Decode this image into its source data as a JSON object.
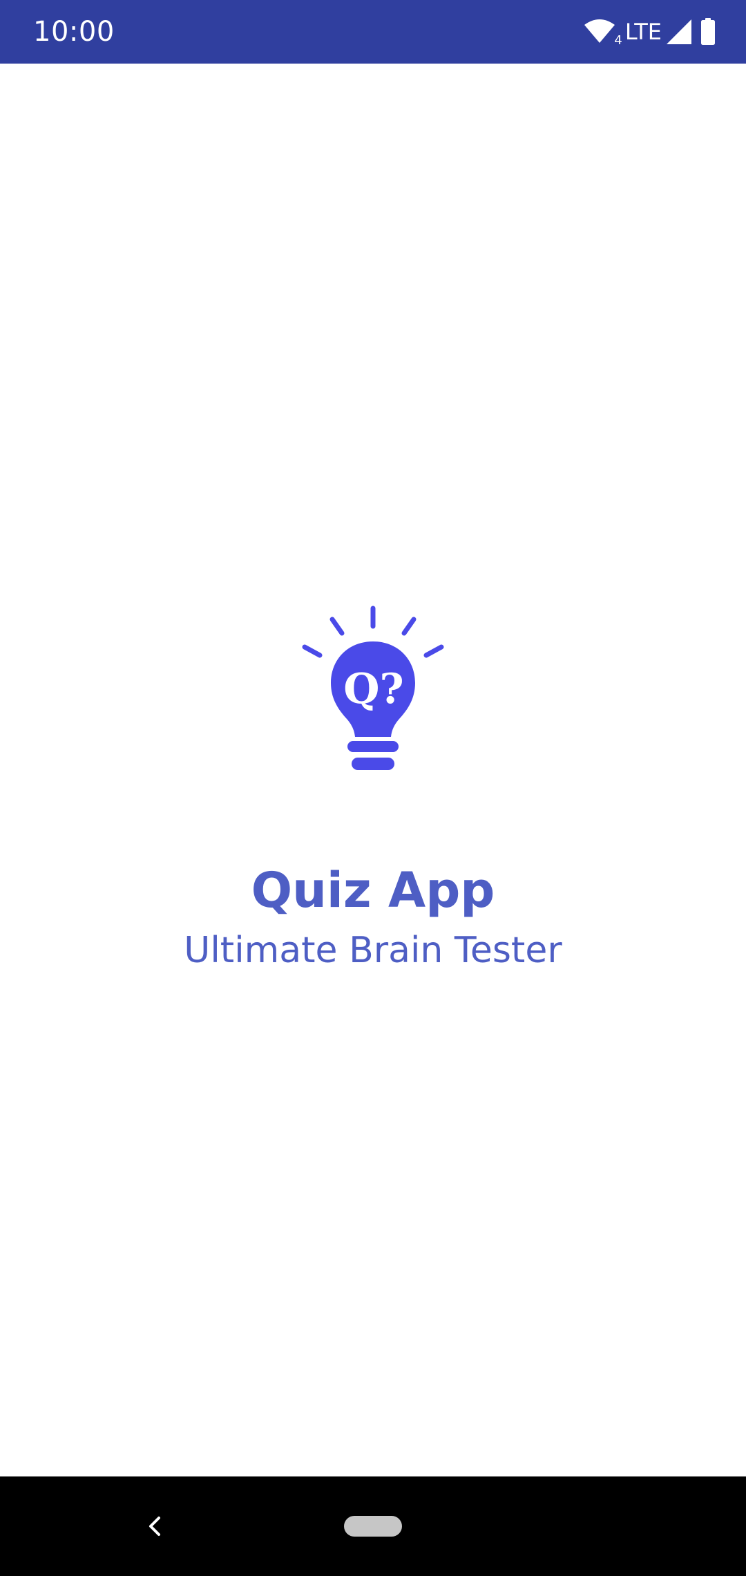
{
  "status_bar": {
    "time": "10:00",
    "network_sub": "4",
    "network_type": "LTE",
    "background_color": "#303F9F",
    "icons": [
      "wifi-icon",
      "signal-icon",
      "battery-icon"
    ]
  },
  "splash": {
    "logo_icon": "lightbulb-question-icon",
    "logo_text": "Q?",
    "logo_color": "#4A4AE8",
    "title": "Quiz App",
    "subtitle": "Ultimate Brain Tester",
    "text_color": "#4E5EC4"
  },
  "nav_bar": {
    "icons": [
      "back-icon",
      "home-pill-icon"
    ]
  }
}
